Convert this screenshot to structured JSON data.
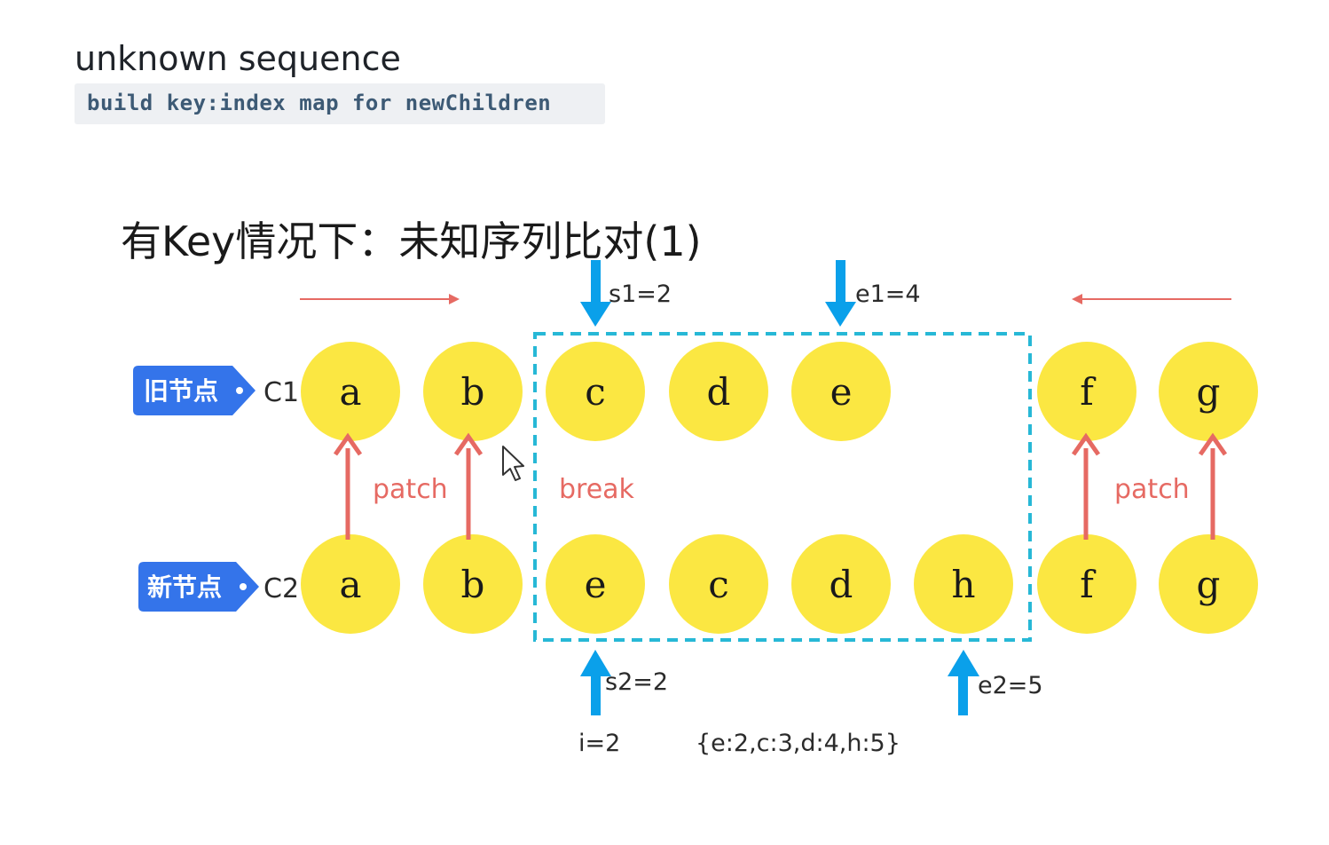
{
  "header": {
    "title": "unknown sequence",
    "code": "build key:index map for newChildren"
  },
  "slide": {
    "title": "有Key情况下：未知序列比对(1)"
  },
  "rows": {
    "old": {
      "tag": "旧节点",
      "label": "C1",
      "nodes": [
        "a",
        "b",
        "c",
        "d",
        "e",
        "f",
        "g"
      ]
    },
    "new": {
      "tag": "新节点",
      "label": "C2",
      "nodes": [
        "a",
        "b",
        "e",
        "c",
        "d",
        "h",
        "f",
        "g"
      ]
    }
  },
  "pointers": {
    "s1": "s1=2",
    "e1": "e1=4",
    "s2": "s2=2",
    "e2": "e2=5"
  },
  "labels": {
    "patch_left": "patch",
    "patch_right": "patch",
    "break": "break",
    "i": "i=2",
    "map": "{e:2,c:3,d:4,h:5}"
  },
  "colors": {
    "node_fill": "#fbe742",
    "pointer_blue": "#0aa0ea",
    "tag_blue": "#3474ea",
    "patch_red": "#e66a63",
    "box_dash": "#27b8d6"
  }
}
